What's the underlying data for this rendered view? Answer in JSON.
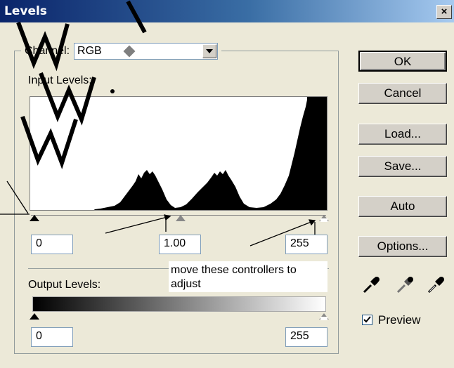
{
  "window": {
    "title": "Levels",
    "close_glyph": "×"
  },
  "channel": {
    "label": "Channel:",
    "value": "RGB"
  },
  "input_levels": {
    "label": "Input Levels:",
    "black": "0",
    "gamma": "1.00",
    "white": "255"
  },
  "output_levels": {
    "label": "Output Levels:",
    "black": "0",
    "white": "255"
  },
  "annotation": {
    "text": "move these controllers to adjust"
  },
  "buttons": {
    "ok": "OK",
    "cancel": "Cancel",
    "load": "Load...",
    "save": "Save...",
    "auto": "Auto",
    "options": "Options..."
  },
  "eyedroppers": [
    "black-eyedropper-icon",
    "gray-eyedropper-icon",
    "white-eyedropper-icon"
  ],
  "preview": {
    "label": "Preview",
    "checked": true
  },
  "colors": {
    "title_start": "#0a246a",
    "title_end": "#a6caf0",
    "dialog_bg": "#ece9d8"
  }
}
